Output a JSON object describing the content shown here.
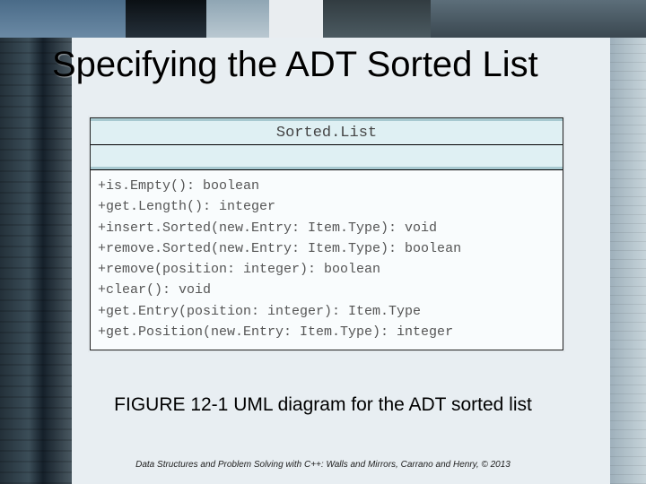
{
  "heading": "Specifying the ADT Sorted List",
  "uml": {
    "class_name": "Sorted.List",
    "methods": [
      "+is.Empty(): boolean",
      "+get.Length(): integer",
      "+insert.Sorted(new.Entry: Item.Type): void",
      "+remove.Sorted(new.Entry: Item.Type): boolean",
      "+remove(position: integer): boolean",
      "+clear(): void",
      "+get.Entry(position: integer): Item.Type",
      "+get.Position(new.Entry: Item.Type): integer"
    ]
  },
  "caption": "FIGURE 12-1 UML diagram for the ADT sorted list",
  "footer": "Data Structures and Problem Solving with C++: Walls and Mirrors, Carrano and Henry, © 2013"
}
